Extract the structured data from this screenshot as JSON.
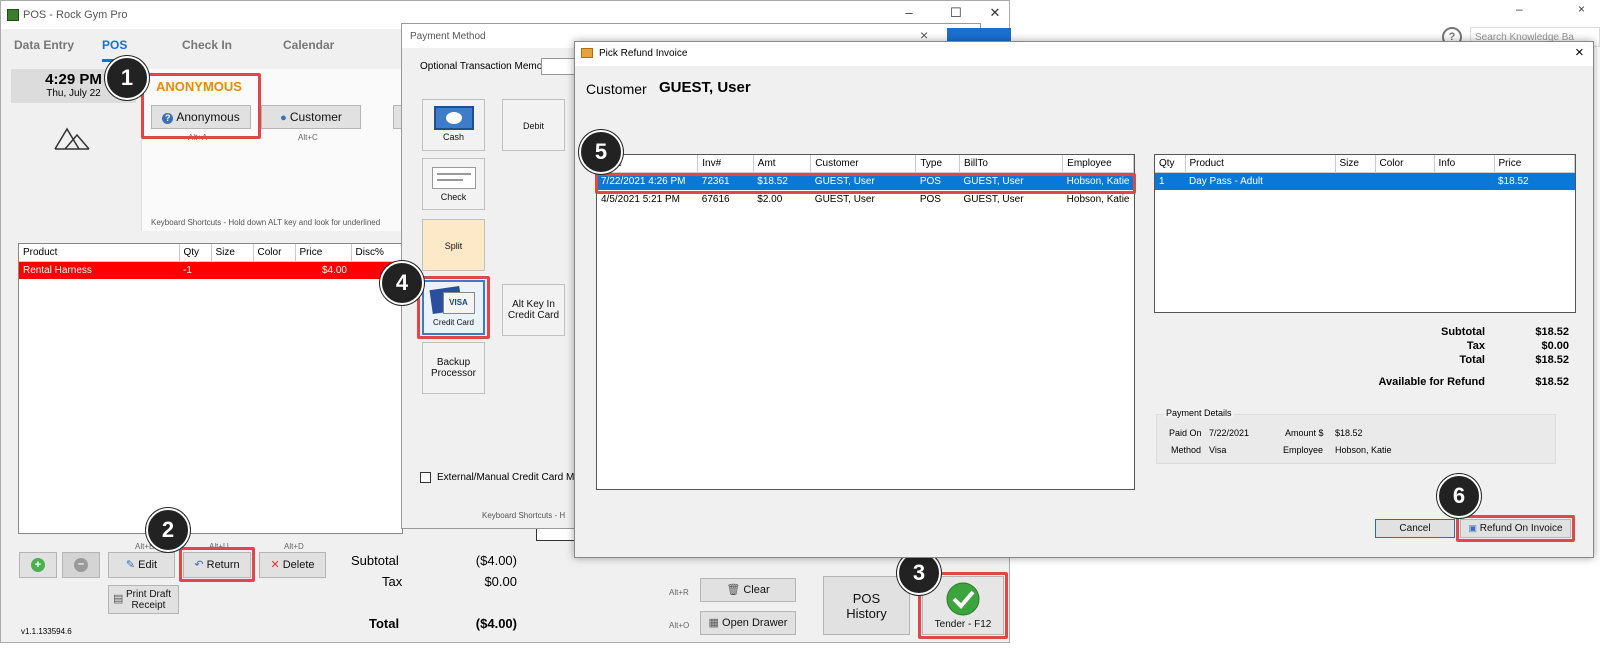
{
  "background_window": {
    "help_glyph": "?",
    "search_placeholder": "Search Knowledge Ba",
    "minimize": "–",
    "close": "×"
  },
  "pos": {
    "title": "POS - Rock Gym Pro",
    "tabs": [
      "Data Entry",
      "POS",
      "Check In",
      "Calendar"
    ],
    "time": "4:29 PM",
    "date": "Thu, July 22",
    "anonymous_heading": "ANONYMOUS",
    "anonymous_button": "Anonymous",
    "anonymous_hint": "Alt+A",
    "customer_button": "Customer",
    "customer_hint": "Alt+C",
    "keyboard_shortcuts": "Keyboard Shortcuts - Hold down ALT key and look for underlined",
    "line_items": {
      "headers": [
        "Product",
        "Qty",
        "Size",
        "Color",
        "Price",
        "Disc%"
      ],
      "rows": [
        [
          "Rental Harness",
          "-1",
          "",
          "",
          "$4.00",
          ""
        ]
      ]
    },
    "edit_hint": "Alt+E",
    "edit_button": "Edit",
    "return_hint": "Alt+U",
    "return_button": "Return",
    "delete_hint": "Alt+D",
    "delete_button": "Delete",
    "print_draft_line1": "Print Draft",
    "print_draft_line2": "Receipt",
    "subtotal_label": "Subtotal",
    "subtotal_value": "($4.00)",
    "tax_label": "Tax",
    "tax_value": "$0.00",
    "total_label": "Total",
    "total_value": "($4.00)",
    "clear_hint": "Alt+R",
    "clear_button": "Clear",
    "open_drawer_hint": "Alt+O",
    "open_drawer_button": "Open Drawer",
    "pos_history_line1": "POS",
    "pos_history_line2": "History",
    "tender_button": "Tender - F12",
    "version": "v1.1.133594.6"
  },
  "payment_method": {
    "title": "Payment Method",
    "memo_label": "Optional Transaction Memo",
    "buttons": {
      "cash": "Cash",
      "check": "Check",
      "debit": "Debit",
      "split": "Split",
      "credit_card": "Credit Card",
      "alt_key_line1": "Alt Key In",
      "alt_key_line2": "Credit Card",
      "backup_line1": "Backup",
      "backup_line2": "Processor"
    },
    "external_checkbox_label": "External/Manual Credit Card Mode",
    "keyboard_shortcuts": "Keyboard Shortcuts - H",
    "close": "×"
  },
  "refund_dialog": {
    "title": "Pick Refund Invoice",
    "customer_label": "Customer",
    "customer_name": "GUEST, User",
    "close": "×",
    "invoices": {
      "headers": [
        "Date",
        "Inv#",
        "Amt",
        "Customer",
        "Type",
        "BillTo",
        "Employee"
      ],
      "rows": [
        [
          "7/22/2021 4:26 PM",
          "72361",
          "$18.52",
          "GUEST, User",
          "POS",
          "GUEST, User",
          "Hobson, Katie"
        ],
        [
          "4/5/2021 5:21 PM",
          "67616",
          "$2.00",
          "GUEST, User",
          "POS",
          "GUEST, User",
          "Hobson, Katie"
        ]
      ]
    },
    "items": {
      "headers": [
        "Qty",
        "Product",
        "Size",
        "Color",
        "Info",
        "Price"
      ],
      "rows": [
        [
          "1",
          "Day Pass - Adult",
          "",
          "",
          "",
          "$18.52"
        ]
      ]
    },
    "subtotal_label": "Subtotal",
    "subtotal_value": "$18.52",
    "tax_label": "Tax",
    "tax_value": "$0.00",
    "total_label": "Total",
    "total_value": "$18.52",
    "available_label": "Available for Refund",
    "available_value": "$18.52",
    "payment_details_title": "Payment Details",
    "paid_on_label": "Paid On",
    "paid_on_value": "7/22/2021",
    "amount_label": "Amount $",
    "amount_value": "$18.52",
    "method_label": "Method",
    "method_value": "Visa",
    "employee_label": "Employee",
    "employee_value": "Hobson, Katie",
    "cancel_button": "Cancel",
    "refund_button": "Refund On Invoice"
  },
  "step_badges": [
    "1",
    "2",
    "3",
    "4",
    "5",
    "6"
  ],
  "colors": {
    "accent": "#1a6fd0",
    "anonymous_orange": "#f08a00",
    "callout_red": "#e04848",
    "row_red": "#ff0000",
    "selection_blue": "#0a78d7"
  }
}
